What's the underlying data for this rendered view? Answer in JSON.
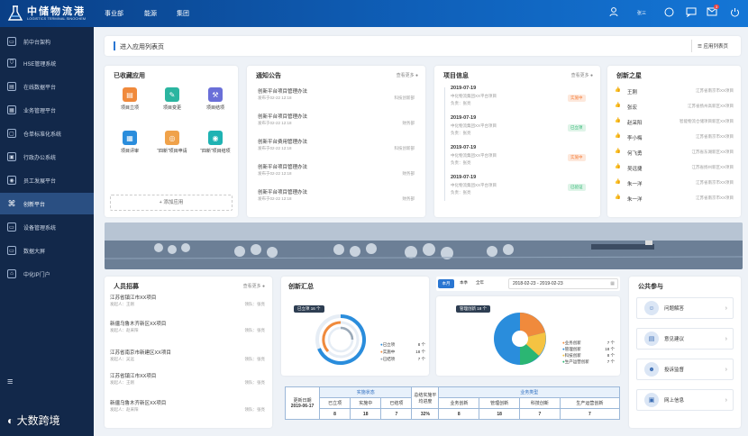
{
  "header": {
    "logo_title": "中储物流港",
    "logo_subtitle": "LOGISTICS TERMINAL SINOCHEM",
    "nav": [
      "事业部",
      "能源",
      "集团"
    ],
    "user": "张三",
    "icons": [
      "user-icon",
      "circle-icon",
      "message-icon",
      "mail-icon",
      "power-icon"
    ],
    "mail_count": "3",
    "colors": {
      "bar": "#0f5fb8",
      "sidebar": "#12284a",
      "accent": "#2a76d2"
    }
  },
  "sidebar": {
    "items": [
      {
        "label": "前中台架构",
        "icon": "monitor-icon"
      },
      {
        "label": "HSE管理系统",
        "icon": "shield-icon"
      },
      {
        "label": "在线数据平台",
        "icon": "chart-icon"
      },
      {
        "label": "业务管理平台",
        "icon": "folder-icon"
      },
      {
        "label": "仓单标准化系统",
        "icon": "doc-icon"
      },
      {
        "label": "行政办公系统",
        "icon": "office-icon"
      },
      {
        "label": "员工发展平台",
        "icon": "person-icon"
      },
      {
        "label": "创新平台",
        "icon": "command-icon",
        "active": true
      },
      {
        "label": "设备管理系统",
        "icon": "device-icon"
      },
      {
        "label": "数据大屏",
        "icon": "screen-icon"
      },
      {
        "label": "中化IP门户",
        "icon": "home-icon"
      }
    ],
    "menu_icon": "menu-icon"
  },
  "breadcrumb": {
    "label": "进入应用列表页",
    "right": "应用列表页"
  },
  "apps": {
    "title": "已收藏应用",
    "items": [
      {
        "label": "项目立项",
        "color": "#f08a3c",
        "icon": "doc-icon"
      },
      {
        "label": "项目变更",
        "color": "#2bb5a0",
        "icon": "edit-icon"
      },
      {
        "label": "项目结项",
        "color": "#6a6fd8",
        "icon": "gavel-icon"
      },
      {
        "label": "项目评审",
        "color": "#2a8ddc",
        "icon": "review-icon"
      },
      {
        "label": "“四新”项目申请",
        "color": "#f0a24a",
        "icon": "apply-icon"
      },
      {
        "label": "“四新”项目结项",
        "color": "#1fb3b3",
        "icon": "finish-icon"
      }
    ],
    "add_label": "添加应用"
  },
  "notices": {
    "title": "通知公告",
    "more": "查看更多",
    "items": [
      {
        "title": "创新平台项目管理办法",
        "date": "发布于02-22 12:18",
        "dept": "科技创新部"
      },
      {
        "title": "创新平台项目管理办法",
        "date": "发布于02-22 12:18",
        "dept": "财务部"
      },
      {
        "title": "创新平台费用管理办法",
        "date": "发布于02-22 12:18",
        "dept": "科技创新部"
      },
      {
        "title": "创新平台项目管理办法",
        "date": "发布于02-22 12:18",
        "dept": "财务部"
      },
      {
        "title": "创新平台项目管理办法",
        "date": "发布于02-22 12:18",
        "dept": "财务部"
      }
    ]
  },
  "projects": {
    "title": "项目信息",
    "more": "查看更多",
    "items": [
      {
        "date": "2019-07-19",
        "name": "中化物流集团XX平台项目",
        "owner": "负责：张亮",
        "status": "实施中",
        "color": "#f5803e"
      },
      {
        "date": "2019-07-19",
        "name": "中化物流集团XX平台项目",
        "owner": "负责：张亮",
        "status": "已立项",
        "color": "#2bb673"
      },
      {
        "date": "2019-07-19",
        "name": "中化物流集团XX平台项目",
        "owner": "负责：张亮",
        "status": "实施中",
        "color": "#f5803e"
      },
      {
        "date": "2019-07-19",
        "name": "中化物流集团XX平台项目",
        "owner": "负责：张亮",
        "status": "已验证",
        "color": "#2bb673"
      }
    ]
  },
  "stars": {
    "title": "创新之星",
    "items": [
      {
        "name": "王刚",
        "project": "江苏省南京市XX项目"
      },
      {
        "name": "张宏",
        "project": "江苏省扬州高新区XX项目"
      },
      {
        "name": "赵采阳",
        "project": "智能物流仓储项目新区XX项目"
      },
      {
        "name": "李小梅",
        "project": "江苏省南京市XX项目"
      },
      {
        "name": "何飞勇",
        "project": "江苏省东湖新区XX项目"
      },
      {
        "name": "吴远捷",
        "project": "江苏省扬州新区XX项目"
      },
      {
        "name": "朱一洋",
        "project": "江苏省南京市XX项目"
      },
      {
        "name": "朱一洋",
        "project": "江苏省南京市XX项目"
      }
    ]
  },
  "recruit": {
    "title": "人员招募",
    "more": "查看更多",
    "items": [
      {
        "title": "江苏省镇江市XX项目",
        "owner": "发起人：王刚",
        "dept": "领队：张亮"
      },
      {
        "title": "新疆乌鲁木齐新区XX项目",
        "owner": "发起人：赵采阳",
        "dept": "领队：张亮"
      },
      {
        "title": "江苏省南京市新建区XX项目",
        "owner": "发起人：吴远",
        "dept": "领队：张亮"
      },
      {
        "title": "江苏省镇江市XX项目",
        "owner": "发起人：王刚",
        "dept": "领队：张亮"
      },
      {
        "title": "新疆乌鲁木齐新区XX项目",
        "owner": "发起人：赵采阳",
        "dept": "领队：张亮"
      }
    ]
  },
  "innovation": {
    "title": "创新汇总",
    "tooltip": "已立项 16 个",
    "legend": [
      {
        "label": "已立项",
        "value": "8 个",
        "color": "#2a8ddc"
      },
      {
        "label": "实施中",
        "value": "18 个",
        "color": "#f08a3c"
      },
      {
        "label": "已结项",
        "value": "7 个",
        "color": "#9aa9b8"
      }
    ]
  },
  "filters": {
    "tabs": [
      "本月",
      "本季",
      "全年"
    ],
    "date_from": "2018-02-23",
    "date_sep": "-",
    "date_to": "2019-02-23",
    "calendar_icon": "calendar-icon"
  },
  "mgmt": {
    "tooltip": "管理创新 18 个",
    "legend": [
      {
        "label": "业务创新",
        "value": "7 个",
        "color": "#f08a3c"
      },
      {
        "label": "管理创新",
        "value": "18 个",
        "color": "#2a8ddc"
      },
      {
        "label": "科技创新",
        "value": "8 个",
        "color": "#f5c342"
      },
      {
        "label": "生产运营创新",
        "value": "7 个",
        "color": "#2bb673"
      }
    ]
  },
  "stats_table": {
    "update_label": "更新日期",
    "update_date": "2019-06-17",
    "status_header": "实施状态",
    "status_cols": [
      "已立项",
      "实施中",
      "已结项"
    ],
    "status_vals": [
      "8",
      "18",
      "7"
    ],
    "progress_label": "总结实施平均进度",
    "progress_val": "32%",
    "type_header": "业务类型",
    "type_cols": [
      "业务创新",
      "管理创新",
      "科技创新",
      "生产运营创新"
    ],
    "type_vals": [
      "8",
      "18",
      "7",
      "7"
    ]
  },
  "public": {
    "title": "公共参与",
    "items": [
      {
        "label": "问题解答",
        "icon": "people-icon"
      },
      {
        "label": "意见建议",
        "icon": "note-icon"
      },
      {
        "label": "投诉监督",
        "icon": "group-icon"
      },
      {
        "label": "网上信息",
        "icon": "id-icon"
      }
    ]
  },
  "watermark": "大数跨境"
}
